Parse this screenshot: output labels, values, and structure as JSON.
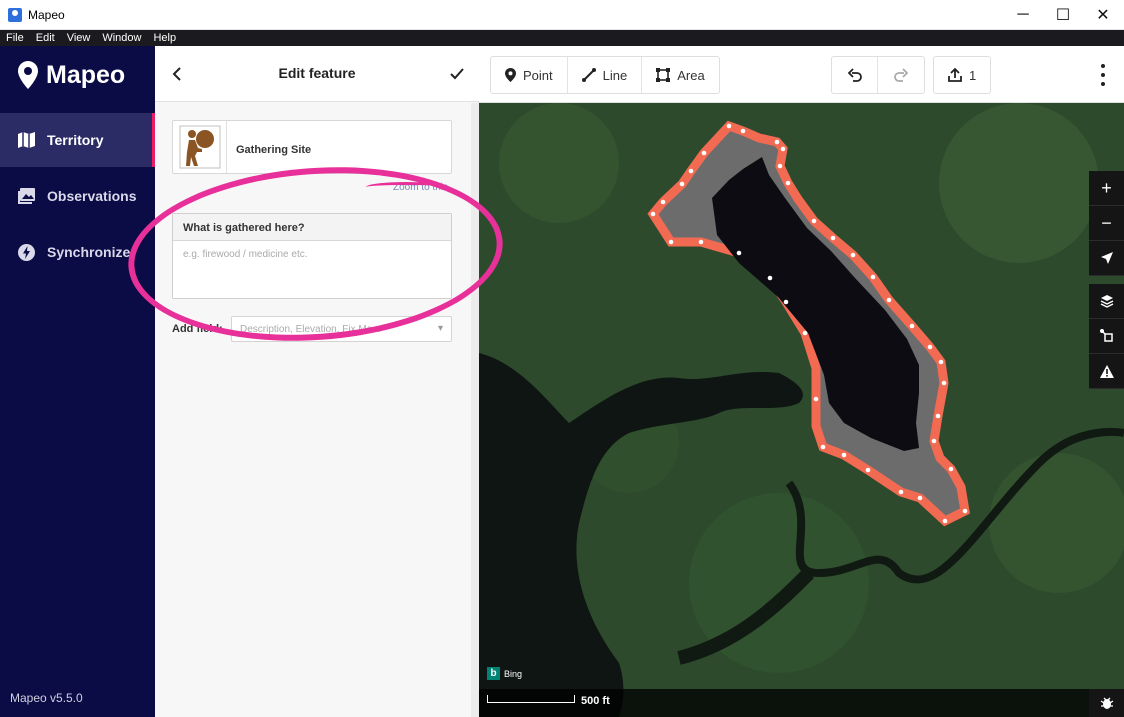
{
  "window": {
    "title": "Mapeo",
    "controls": {
      "minimize": "─",
      "maximize": "☐",
      "close": "✕"
    }
  },
  "menubar": {
    "items": [
      "File",
      "Edit",
      "View",
      "Window",
      "Help"
    ]
  },
  "sidebar": {
    "logo": "Mapeo",
    "items": [
      {
        "label": "Territory",
        "icon": "map-icon",
        "active": true
      },
      {
        "label": "Observations",
        "icon": "photo-icon",
        "active": false
      },
      {
        "label": "Synchronize",
        "icon": "lightning-icon",
        "active": false
      }
    ],
    "version": "Mapeo v5.5.0"
  },
  "panel": {
    "back": "<",
    "title": "Edit feature",
    "confirm": "✓",
    "preset": {
      "name": "Gathering Site",
      "icon": "gathering-person-icon"
    },
    "zoom_link": "Zoom to this",
    "field": {
      "label": "What is gathered here?",
      "placeholder": "e.g. firewood / medicine etc.",
      "value": ""
    },
    "add_field": {
      "label": "Add field:",
      "placeholder": "Description, Elevation, Fix Me..."
    }
  },
  "toolbar": {
    "draw_tools": [
      {
        "label": "Point",
        "icon": "map-pin-icon"
      },
      {
        "label": "Line",
        "icon": "line-icon"
      },
      {
        "label": "Area",
        "icon": "area-icon"
      }
    ],
    "undo": "undo-icon",
    "redo": "redo-icon",
    "upload_count": "1"
  },
  "map": {
    "attribution": "Bing",
    "scale_label": "500 ft",
    "controls": [
      "zoom-in-icon",
      "zoom-out-icon",
      "locate-icon",
      "layers-icon",
      "map-data-icon",
      "issues-icon"
    ],
    "colors": {
      "area_outline": "#f26a52",
      "area_fill": "#6d6d6d"
    }
  }
}
